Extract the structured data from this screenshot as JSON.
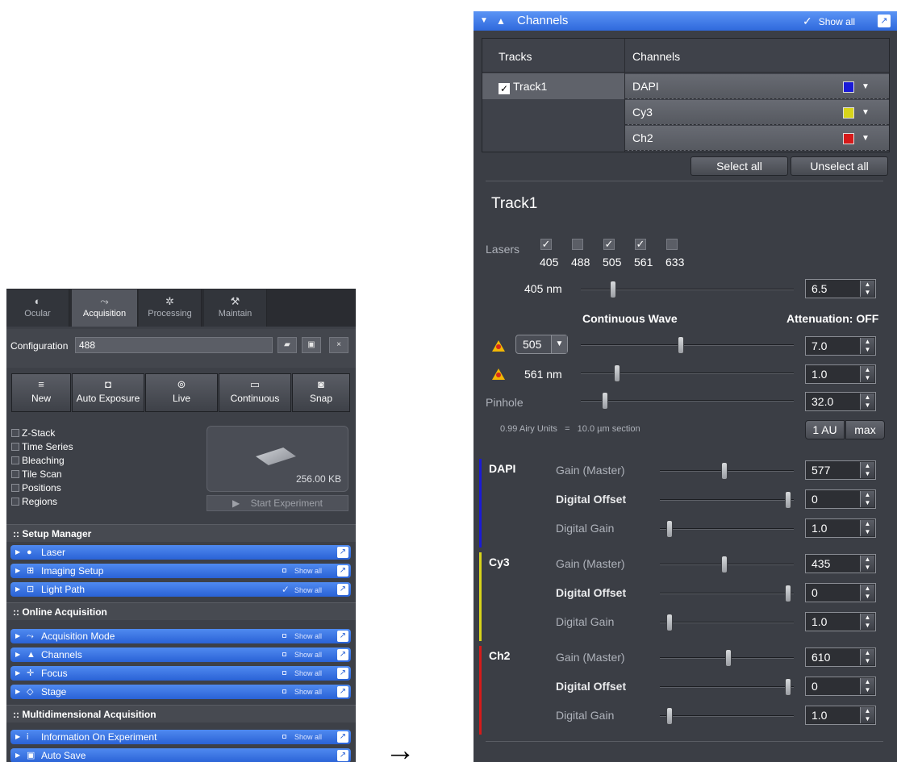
{
  "left": {
    "tabs": [
      {
        "label": "Ocular",
        "icon": "ocular-icon"
      },
      {
        "label": "Acquisition",
        "icon": "acquisition-icon"
      },
      {
        "label": "Processing",
        "icon": "processing-icon"
      },
      {
        "label": "Maintain",
        "icon": "maintain-icon"
      }
    ],
    "configuration": {
      "label": "Configuration",
      "value": "488"
    },
    "actions": [
      "New",
      "Auto Exposure",
      "Live",
      "Continuous",
      "Snap"
    ],
    "options": [
      "Z-Stack",
      "Time Series",
      "Bleaching",
      "Tile Scan",
      "Positions",
      "Regions"
    ],
    "preview_size": "256.00 KB",
    "start_label": "Start Experiment",
    "sections": {
      "setup": "Setup Manager",
      "online": "Online Acquisition",
      "multi": "Multidimensional Acquisition"
    },
    "showall": "Show all",
    "tools": [
      {
        "label": "Laser",
        "section": "setup",
        "showall": false
      },
      {
        "label": "Imaging Setup",
        "section": "setup",
        "showall": true,
        "checked": false
      },
      {
        "label": "Light Path",
        "section": "setup",
        "showall": true,
        "checked": true
      },
      {
        "label": "Acquisition Mode",
        "section": "online",
        "showall": true,
        "checked": false
      },
      {
        "label": "Channels",
        "section": "online",
        "showall": true,
        "checked": false
      },
      {
        "label": "Focus",
        "section": "online",
        "showall": true,
        "checked": false
      },
      {
        "label": "Stage",
        "section": "online",
        "showall": true,
        "checked": false
      },
      {
        "label": "Information On Experiment",
        "section": "multi",
        "showall": true,
        "checked": false
      },
      {
        "label": "Auto Save",
        "section": "multi",
        "showall": false
      }
    ]
  },
  "right": {
    "header": {
      "title": "Channels",
      "showall": "Show all",
      "checked": true
    },
    "tracks": {
      "col_tracks": "Tracks",
      "col_channels": "Channels",
      "track": "Track1"
    },
    "channels": [
      {
        "name": "DAPI",
        "color": "#1a1ad6"
      },
      {
        "name": "Cy3",
        "color": "#d8d41a"
      },
      {
        "name": "Ch2",
        "color": "#d61a1a"
      }
    ],
    "select_all": "Select all",
    "unselect_all": "Unselect all",
    "track_title": "Track1",
    "lasers_label": "Lasers",
    "lasers": [
      {
        "nm": "405",
        "on": true
      },
      {
        "nm": "488",
        "on": false
      },
      {
        "nm": "505",
        "on": true
      },
      {
        "nm": "561",
        "on": true
      },
      {
        "nm": "633",
        "on": false
      }
    ],
    "laser_405": {
      "label": "405 nm",
      "value": "6.5",
      "level": 0.14
    },
    "continuous_wave": "Continuous Wave",
    "attenuation": "Attenuation: OFF",
    "laser_505": {
      "label": "505",
      "value": "7.0",
      "level": 0.47
    },
    "laser_561": {
      "label": "561 nm",
      "value": "1.0",
      "level": 0.16
    },
    "pinhole": {
      "label": "Pinhole",
      "value": "32.0",
      "level": 0.1
    },
    "airy": {
      "text": "0.99 Airy Units   =   10.0 µm section",
      "btn1": "1 AU",
      "btn2": "max"
    },
    "gain_rows": [
      {
        "channel": "DAPI",
        "color": "#1a1ad6",
        "gain": {
          "label": "Gain (Master)",
          "value": "577",
          "level": 0.48
        },
        "offset": {
          "label": "Digital Offset",
          "value": "0",
          "level": 0.98
        },
        "dgain": {
          "label": "Digital Gain",
          "value": "1.0",
          "level": 0.05
        }
      },
      {
        "channel": "Cy3",
        "color": "#d8d41a",
        "gain": {
          "label": "Gain (Master)",
          "value": "435",
          "level": 0.48
        },
        "offset": {
          "label": "Digital Offset",
          "value": "0",
          "level": 0.98
        },
        "dgain": {
          "label": "Digital Gain",
          "value": "1.0",
          "level": 0.05
        }
      },
      {
        "channel": "Ch2",
        "color": "#d61a1a",
        "gain": {
          "label": "Gain (Master)",
          "value": "610",
          "level": 0.51
        },
        "offset": {
          "label": "Digital Offset",
          "value": "0",
          "level": 0.98
        },
        "dgain": {
          "label": "Digital Gain",
          "value": "1.0",
          "level": 0.05
        }
      }
    ]
  },
  "arrow": "→"
}
